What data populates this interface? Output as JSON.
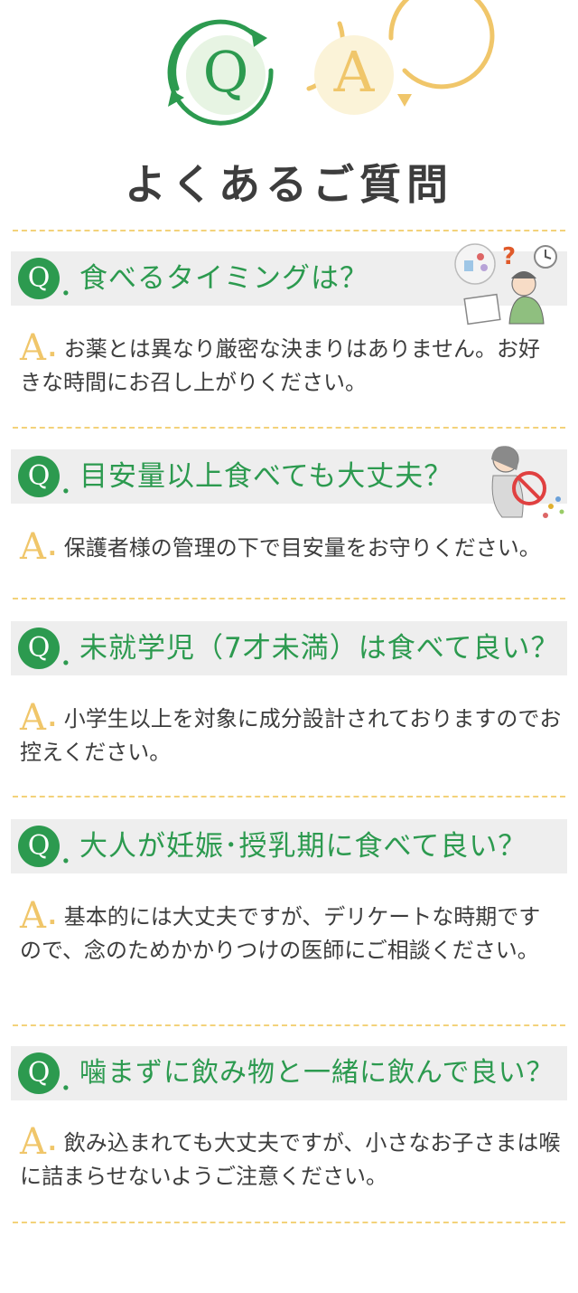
{
  "header": {
    "q_mark": "Q",
    "a_mark": "A",
    "title": "よくあるご質問",
    "colors": {
      "green": "#2c9a4f",
      "yellow": "#f0c66a",
      "divider": "#f3d27a"
    }
  },
  "faq": [
    {
      "q_mark": "Q",
      "question": "食べるタイミングは？",
      "a_mark": "A",
      "answer": "お薬とは異なり厳密な決まりはありません。お好きな時間にお召し上がりください。",
      "illustration": "thinking-person-with-medicine-and-clock-icon"
    },
    {
      "q_mark": "Q",
      "question": "目安量以上食べても大丈夫？",
      "a_mark": "A",
      "answer": "保護者様の管理の下で目安量をお守りください。",
      "illustration": "sick-person-no-overeating-icon"
    },
    {
      "q_mark": "Q",
      "question": "未就学児（7才未満）は食べて良い？",
      "a_mark": "A",
      "answer": "小学生以上を対象に成分設計されておりますのでお控えください。"
    },
    {
      "q_mark": "Q",
      "question": "大人が妊娠･授乳期に食べて良い？",
      "a_mark": "A",
      "answer": "基本的には大丈夫ですが、デリケートな時期ですので、念のためかかりつけの医師にご相談ください。"
    },
    {
      "q_mark": "Q",
      "question": "噛まずに飲み物と一緒に飲んで良い？",
      "a_mark": "A",
      "answer": "飲み込まれても大丈夫ですが、小さなお子さまは喉に詰まらせないようご注意ください。"
    }
  ]
}
